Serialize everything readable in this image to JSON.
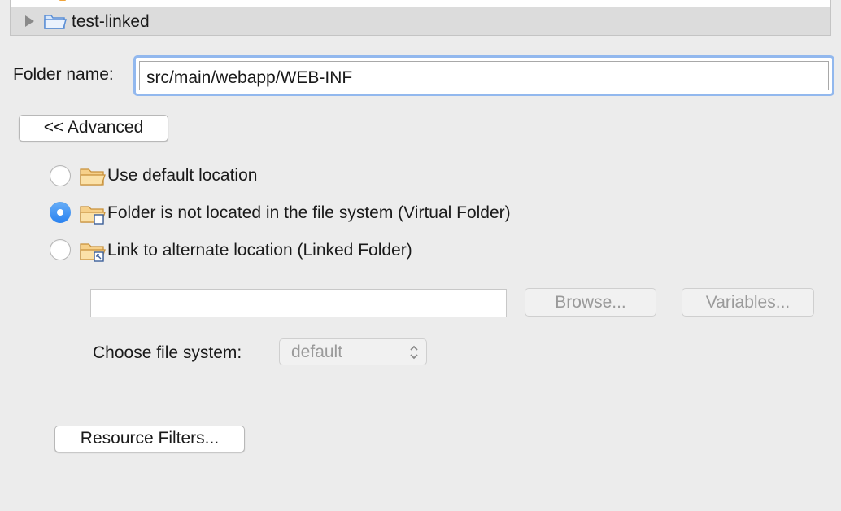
{
  "tree": {
    "items": [
      {
        "label": "test-linked",
        "icon": "linked-folder-icon",
        "expandable": true
      }
    ]
  },
  "folder_name": {
    "label": "Folder name:",
    "value": "src/main/webapp/WEB-INF"
  },
  "advanced_button": {
    "label": "<< Advanced"
  },
  "options": [
    {
      "label": "Use default location",
      "checked": false,
      "icon": "folder-icon"
    },
    {
      "label": "Folder is not located in the file system (Virtual Folder)",
      "checked": true,
      "icon": "virtual-folder-icon"
    },
    {
      "label": "Link to alternate location (Linked Folder)",
      "checked": false,
      "icon": "linked-folder-icon"
    }
  ],
  "location": {
    "value": "",
    "browse_label": "Browse...",
    "variables_label": "Variables...",
    "enabled": false
  },
  "file_system": {
    "label": "Choose file system:",
    "selected": "default",
    "enabled": false
  },
  "resource_filters_button": {
    "label": "Resource Filters..."
  },
  "colors": {
    "accent": "#2a82f0",
    "focus_ring": "#92b8ee",
    "folder": "#f4c06a",
    "background": "#ececec"
  }
}
